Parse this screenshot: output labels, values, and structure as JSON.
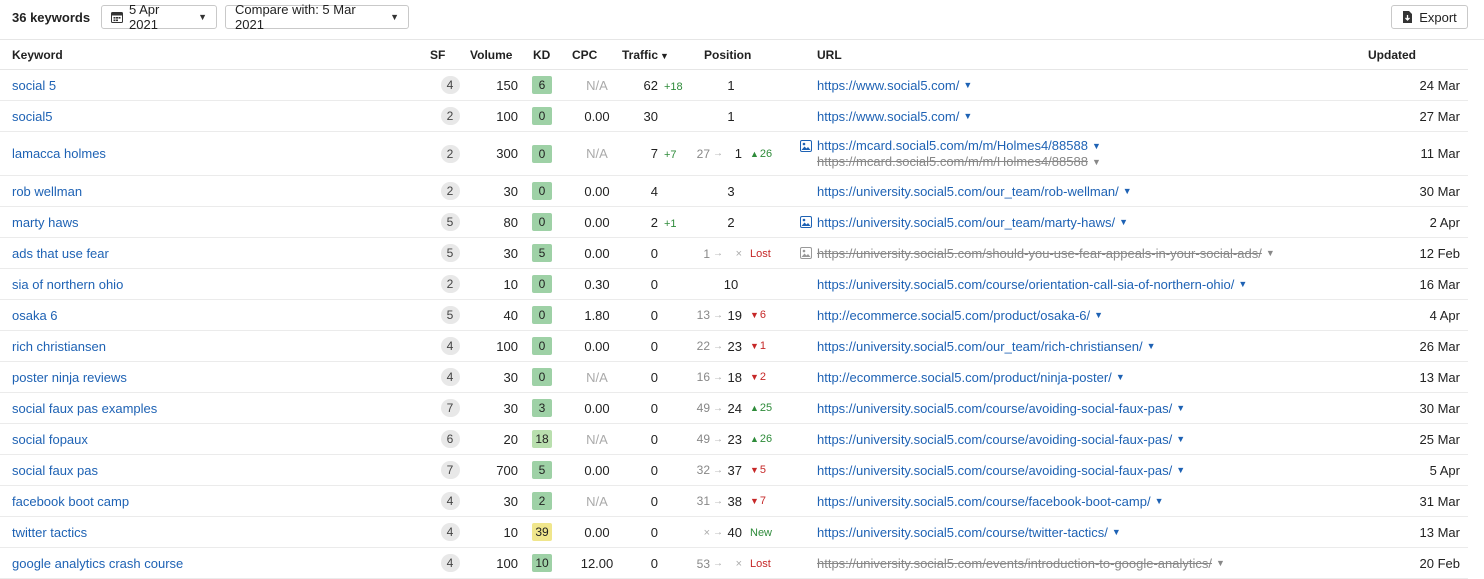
{
  "toolbar": {
    "keywords_count": "36 keywords",
    "date_label": "5 Apr 2021",
    "compare_label": "Compare with: 5 Mar 2021",
    "export_label": "Export"
  },
  "columns": {
    "keyword": "Keyword",
    "sf": "SF",
    "volume": "Volume",
    "kd": "KD",
    "cpc": "CPC",
    "traffic": "Traffic",
    "position": "Position",
    "url": "URL",
    "updated": "Updated"
  },
  "colors": {
    "link": "#1e62b4",
    "kd_green": "#9ed1a6",
    "kd_light_green": "#b9dfae",
    "kd_yellow": "#f0e68c",
    "positive": "#2e8b3a",
    "negative": "#c62828"
  },
  "rows": [
    {
      "keyword": "social 5",
      "sf": "4",
      "volume": "150",
      "kd": "6",
      "kd_color": "#9ed1a6",
      "cpc": "N/A",
      "traffic": "62",
      "traffic_delta": "+18",
      "pos_from": "",
      "pos_to": "1",
      "pos_change": "",
      "pos_dir": "",
      "url": "https://www.social5.com/",
      "url_strike": false,
      "url_icon": "",
      "url2": ""
    },
    {
      "keyword": "social5",
      "sf": "2",
      "volume": "100",
      "kd": "0",
      "kd_color": "#9ed1a6",
      "cpc": "0.00",
      "traffic": "30",
      "traffic_delta": "",
      "pos_from": "",
      "pos_to": "1",
      "pos_change": "",
      "pos_dir": "",
      "url": "https://www.social5.com/",
      "url_strike": false,
      "url_icon": "",
      "url2": ""
    },
    {
      "keyword": "lamacca holmes",
      "sf": "2",
      "volume": "300",
      "kd": "0",
      "kd_color": "#9ed1a6",
      "cpc": "N/A",
      "traffic": "7",
      "traffic_delta": "+7",
      "pos_from": "27",
      "pos_to": "1",
      "pos_change": "26",
      "pos_dir": "up",
      "url": "https://mcard.social5.com/m/m/Holmes4/88588",
      "url_strike": false,
      "url_icon": "image-icon",
      "url2": "https://mcard.social5.com/m/m/Holmes4/88588"
    },
    {
      "keyword": "rob wellman",
      "sf": "2",
      "volume": "30",
      "kd": "0",
      "kd_color": "#9ed1a6",
      "cpc": "0.00",
      "traffic": "4",
      "traffic_delta": "",
      "pos_from": "",
      "pos_to": "3",
      "pos_change": "",
      "pos_dir": "",
      "url": "https://university.social5.com/our_team/rob-wellman/",
      "url_strike": false,
      "url_icon": "",
      "url2": ""
    },
    {
      "keyword": "marty haws",
      "sf": "5",
      "volume": "80",
      "kd": "0",
      "kd_color": "#9ed1a6",
      "cpc": "0.00",
      "traffic": "2",
      "traffic_delta": "+1",
      "pos_from": "",
      "pos_to": "2",
      "pos_change": "",
      "pos_dir": "",
      "url": "https://university.social5.com/our_team/marty-haws/",
      "url_strike": false,
      "url_icon": "image-icon",
      "url2": ""
    },
    {
      "keyword": "ads that use fear",
      "sf": "5",
      "volume": "30",
      "kd": "5",
      "kd_color": "#9ed1a6",
      "cpc": "0.00",
      "traffic": "0",
      "traffic_delta": "",
      "pos_from": "1",
      "pos_to": "×",
      "pos_change": "Lost",
      "pos_dir": "lost",
      "url": "https://university.social5.com/should-you-use-fear-appeals-in-your-social-ads/",
      "url_strike": true,
      "url_icon": "image-icon-grey",
      "url2": ""
    },
    {
      "keyword": "sia of northern ohio",
      "sf": "2",
      "volume": "10",
      "kd": "0",
      "kd_color": "#9ed1a6",
      "cpc": "0.30",
      "traffic": "0",
      "traffic_delta": "",
      "pos_from": "",
      "pos_to": "10",
      "pos_change": "",
      "pos_dir": "",
      "url": "https://university.social5.com/course/orientation-call-sia-of-northern-ohio/",
      "url_strike": false,
      "url_icon": "",
      "url2": ""
    },
    {
      "keyword": "osaka 6",
      "sf": "5",
      "volume": "40",
      "kd": "0",
      "kd_color": "#9ed1a6",
      "cpc": "1.80",
      "traffic": "0",
      "traffic_delta": "",
      "pos_from": "13",
      "pos_to": "19",
      "pos_change": "6",
      "pos_dir": "down",
      "url": "http://ecommerce.social5.com/product/osaka-6/",
      "url_strike": false,
      "url_icon": "",
      "url2": ""
    },
    {
      "keyword": "rich christiansen",
      "sf": "4",
      "volume": "100",
      "kd": "0",
      "kd_color": "#9ed1a6",
      "cpc": "0.00",
      "traffic": "0",
      "traffic_delta": "",
      "pos_from": "22",
      "pos_to": "23",
      "pos_change": "1",
      "pos_dir": "down",
      "url": "https://university.social5.com/our_team/rich-christiansen/",
      "url_strike": false,
      "url_icon": "",
      "url2": ""
    },
    {
      "keyword": "poster ninja reviews",
      "sf": "4",
      "volume": "30",
      "kd": "0",
      "kd_color": "#9ed1a6",
      "cpc": "N/A",
      "traffic": "0",
      "traffic_delta": "",
      "pos_from": "16",
      "pos_to": "18",
      "pos_change": "2",
      "pos_dir": "down",
      "url": "http://ecommerce.social5.com/product/ninja-poster/",
      "url_strike": false,
      "url_icon": "",
      "url2": ""
    },
    {
      "keyword": "social faux pas examples",
      "sf": "7",
      "volume": "30",
      "kd": "3",
      "kd_color": "#9ed1a6",
      "cpc": "0.00",
      "traffic": "0",
      "traffic_delta": "",
      "pos_from": "49",
      "pos_to": "24",
      "pos_change": "25",
      "pos_dir": "up",
      "url": "https://university.social5.com/course/avoiding-social-faux-pas/",
      "url_strike": false,
      "url_icon": "",
      "url2": ""
    },
    {
      "keyword": "social fopaux",
      "sf": "6",
      "volume": "20",
      "kd": "18",
      "kd_color": "#b9dfae",
      "cpc": "N/A",
      "traffic": "0",
      "traffic_delta": "",
      "pos_from": "49",
      "pos_to": "23",
      "pos_change": "26",
      "pos_dir": "up",
      "url": "https://university.social5.com/course/avoiding-social-faux-pas/",
      "url_strike": false,
      "url_icon": "",
      "url2": ""
    },
    {
      "keyword": "social faux pas",
      "sf": "7",
      "volume": "700",
      "kd": "5",
      "kd_color": "#9ed1a6",
      "cpc": "0.00",
      "traffic": "0",
      "traffic_delta": "",
      "pos_from": "32",
      "pos_to": "37",
      "pos_change": "5",
      "pos_dir": "down",
      "url": "https://university.social5.com/course/avoiding-social-faux-pas/",
      "url_strike": false,
      "url_icon": "",
      "url2": ""
    },
    {
      "keyword": "facebook boot camp",
      "sf": "4",
      "volume": "30",
      "kd": "2",
      "kd_color": "#9ed1a6",
      "cpc": "N/A",
      "traffic": "0",
      "traffic_delta": "",
      "pos_from": "31",
      "pos_to": "38",
      "pos_change": "7",
      "pos_dir": "down",
      "url": "https://university.social5.com/course/facebook-boot-camp/",
      "url_strike": false,
      "url_icon": "",
      "url2": ""
    },
    {
      "keyword": "twitter tactics",
      "sf": "4",
      "volume": "10",
      "kd": "39",
      "kd_color": "#f0e68c",
      "cpc": "0.00",
      "traffic": "0",
      "traffic_delta": "",
      "pos_from": "×",
      "pos_to": "40",
      "pos_change": "New",
      "pos_dir": "new",
      "url": "https://university.social5.com/course/twitter-tactics/",
      "url_strike": false,
      "url_icon": "",
      "url2": ""
    },
    {
      "keyword": "google analytics crash course",
      "sf": "4",
      "volume": "100",
      "kd": "10",
      "kd_color": "#9ed1a6",
      "cpc": "12.00",
      "traffic": "0",
      "traffic_delta": "",
      "pos_from": "53",
      "pos_to": "×",
      "pos_change": "Lost",
      "pos_dir": "lost",
      "url": "https://university.social5.com/events/introduction-to-google-analytics/",
      "url_strike": true,
      "url_icon": "",
      "url2": ""
    }
  ]
}
